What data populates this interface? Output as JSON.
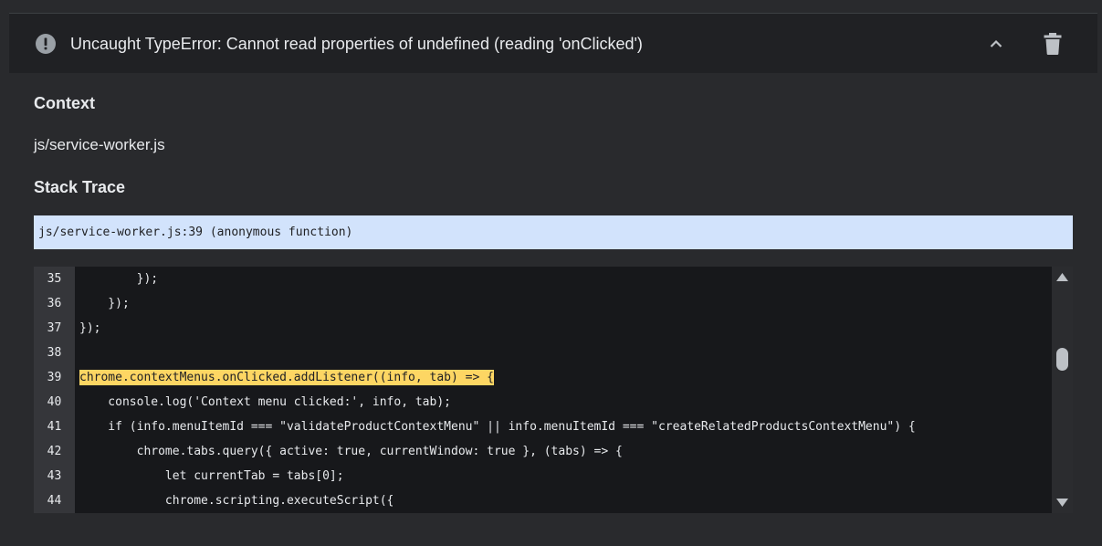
{
  "error": {
    "title": "Uncaught TypeError: Cannot read properties of undefined (reading 'onClicked')",
    "icon": "error-circle-icon"
  },
  "sections": {
    "context_heading": "Context",
    "context_value": "js/service-worker.js",
    "stack_heading": "Stack Trace"
  },
  "stack_trace": {
    "frame": "js/service-worker.js:39 (anonymous function)"
  },
  "code": {
    "highlight_line": 39,
    "lines": [
      {
        "num": "35",
        "text": "        });"
      },
      {
        "num": "36",
        "text": "    });"
      },
      {
        "num": "37",
        "text": "});"
      },
      {
        "num": "38",
        "text": ""
      },
      {
        "num": "39",
        "text": "chrome.contextMenus.onClicked.addListener((info, tab) => {"
      },
      {
        "num": "40",
        "text": "    console.log('Context menu clicked:', info, tab);"
      },
      {
        "num": "41",
        "text": "    if (info.menuItemId === \"validateProductContextMenu\" || info.menuItemId === \"createRelatedProductsContextMenu\") {"
      },
      {
        "num": "42",
        "text": "        chrome.tabs.query({ active: true, currentWindow: true }, (tabs) => {"
      },
      {
        "num": "43",
        "text": "            let currentTab = tabs[0];"
      },
      {
        "num": "44",
        "text": "            chrome.scripting.executeScript({"
      }
    ]
  },
  "colors": {
    "background": "#292a2d",
    "header_background": "#202124",
    "stack_frame_background": "#d2e3fc",
    "code_background": "#17181b",
    "highlight": "#fdd663"
  }
}
